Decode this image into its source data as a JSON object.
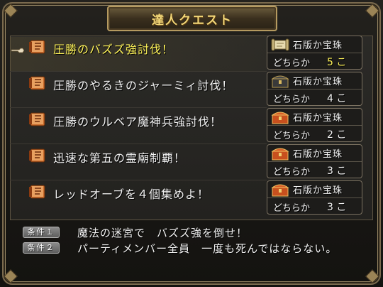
{
  "window": {
    "title": "達人クエスト"
  },
  "quests": [
    {
      "name": "圧勝のバズズ強討伐！",
      "reward_item": "石版か宝珠",
      "reward_choice": "どちらか",
      "reward_qty": "5 こ",
      "reward_icon": "scroll-icon",
      "selected": true
    },
    {
      "name": "圧勝のやるきのジャーミィ討伐！",
      "reward_item": "石版か宝珠",
      "reward_choice": "どちらか",
      "reward_qty": "4 こ",
      "reward_icon": "black-chest-icon",
      "selected": false
    },
    {
      "name": "圧勝のウルベア魔神兵強討伐！",
      "reward_item": "石版か宝珠",
      "reward_choice": "どちらか",
      "reward_qty": "2 こ",
      "reward_icon": "red-chest-icon",
      "selected": false
    },
    {
      "name": "迅速な第五の霊廟制覇！",
      "reward_item": "石版か宝珠",
      "reward_choice": "どちらか",
      "reward_qty": "3 こ",
      "reward_icon": "red-chest-icon",
      "selected": false
    },
    {
      "name": "レッドオーブを４個集めよ！",
      "reward_item": "石版か宝珠",
      "reward_choice": "どちらか",
      "reward_qty": "3 こ",
      "reward_icon": "red-chest-icon",
      "selected": false
    }
  ],
  "conditions": [
    {
      "tag": "条件１",
      "text": "魔法の迷宮で　バズズ強を倒せ！"
    },
    {
      "tag": "条件２",
      "text": "パーティメンバー全員　一度も死んではならない。"
    }
  ],
  "colors": {
    "highlight": "#fff45a",
    "title": "#f2d779",
    "text": "#f2f2f2"
  }
}
